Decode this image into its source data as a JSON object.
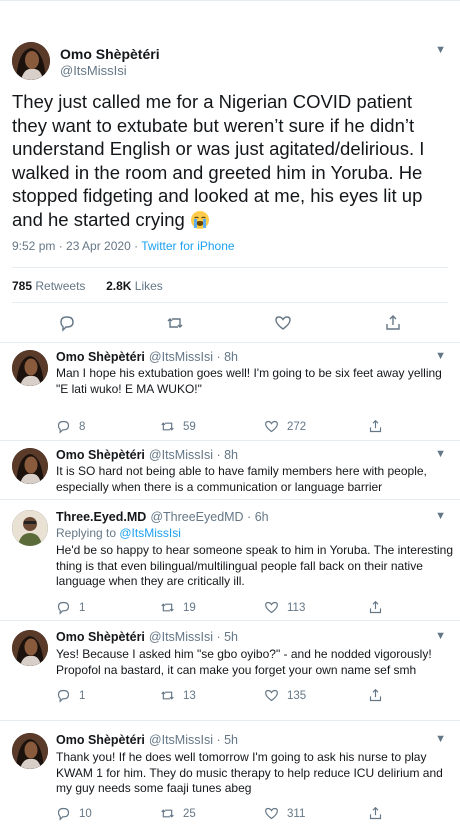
{
  "main_tweet": {
    "display_name": "Omo Shèpètéri",
    "handle": "@ItsMissIsi",
    "text": "They just called me for a Nigerian COVID patient they want to extubate but weren’t sure if he didn’t understand English or was just agitated/delirious. I walked in the room and greeted him in Yoruba. He stopped fidgeting and looked at me, his eyes lit up and he started crying",
    "emoji": "loudly-crying-face-emoji",
    "timestamp": "9:52 pm · 23 Apr 2020 · ",
    "source": "Twitter for iPhone",
    "retweets_count": "785",
    "retweets_label": "Retweets",
    "likes_count": "2.8K",
    "likes_label": "Likes",
    "action_icons": [
      "reply-icon",
      "retweet-icon",
      "like-icon",
      "share-icon"
    ]
  },
  "replies": [
    {
      "display_name": "Omo Shèpètéri",
      "handle": "@ItsMissIsi · 8h",
      "replying_to": "",
      "mention": "",
      "text": "Man I hope his extubation goes well! I'm going to be six feet away yelling \"E lati wuko! E MA WUKO!\"",
      "reply_count": "8",
      "retweet_count": "59",
      "like_count": "272"
    },
    {
      "display_name": "Omo Shèpètéri",
      "handle": "@ItsMissIsi · 8h",
      "replying_to": "",
      "mention": "",
      "text": "It is SO hard not being able to have family members here with people, especially when there is a communication or language barrier",
      "reply_count": "",
      "retweet_count": "",
      "like_count": ""
    },
    {
      "display_name": "Three.Eyed.MD",
      "handle": "@ThreeEyedMD · 6h",
      "replying_to": "Replying to ",
      "mention": "@ItsMissIsi",
      "text": "He'd be so happy to hear someone speak to him in Yoruba. The interesting thing is that even bilingual/multilingual people fall back on their native language when they are critically ill.",
      "reply_count": "1",
      "retweet_count": "19",
      "like_count": "113"
    },
    {
      "display_name": "Omo Shèpètéri",
      "handle": "@ItsMissIsi · 5h",
      "replying_to": "",
      "mention": "",
      "text": "Yes! Because I asked him \"se gbo oyibo?\" - and he nodded vigorously! Propofol na bastard, it can make you forget your own name sef smh",
      "reply_count": "1",
      "retweet_count": "13",
      "like_count": "135"
    },
    {
      "display_name": "Omo Shèpètéri",
      "handle": "@ItsMissIsi · 5h",
      "replying_to": "",
      "mention": "",
      "text": "Thank you! If he does well tomorrow I'm going to ask his nurse to play KWAM 1 for him. They do music therapy to help reduce ICU delirium and my guy needs some faaji tunes abeg",
      "reply_count": "10",
      "retweet_count": "25",
      "like_count": "311"
    }
  ],
  "colors": {
    "text": "#14171a",
    "secondary": "#657786",
    "link": "#1da1f2",
    "divider": "#e6ecf0"
  }
}
